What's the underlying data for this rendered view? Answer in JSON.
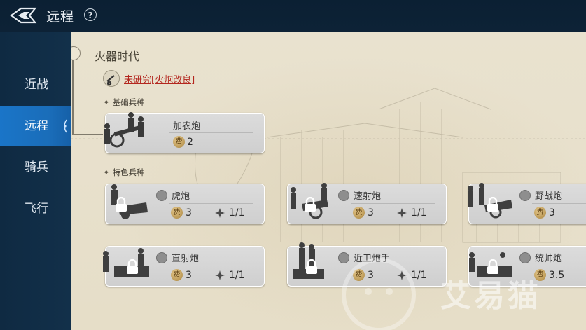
{
  "header": {
    "title": "远程",
    "help_label": "?"
  },
  "sidebar": {
    "items": [
      {
        "label": "近战"
      },
      {
        "label": "远程"
      },
      {
        "label": "骑兵"
      },
      {
        "label": "飞行"
      }
    ],
    "active_index": 1
  },
  "era": {
    "title": "火器时代",
    "research_status": "未研究[火炮改良]"
  },
  "sections": {
    "base": "基础兵种",
    "special": "特色兵种"
  },
  "cost_icon_label": "费",
  "units": {
    "base": [
      {
        "name": "加农炮",
        "cost": "2",
        "icon": "cannon-crew-icon"
      }
    ],
    "special": [
      {
        "name": "虎炮",
        "cost": "3",
        "limit": "1/1",
        "locked": true,
        "type_icon": "sword-icon"
      },
      {
        "name": "速射炮",
        "cost": "3",
        "limit": "1/1",
        "locked": true,
        "type_icon": "shield-icon"
      },
      {
        "name": "野战炮",
        "cost": "3",
        "limit": "",
        "locked": true,
        "type_icon": "shield-icon"
      },
      {
        "name": "直射炮",
        "cost": "3",
        "limit": "1/1",
        "locked": true,
        "type_icon": "shield-icon"
      },
      {
        "name": "近卫炮手",
        "cost": "3",
        "limit": "1/1",
        "locked": true,
        "type_icon": "shield-icon"
      },
      {
        "name": "统帅炮",
        "cost": "3.5",
        "limit": "",
        "locked": true,
        "type_icon": "banner-icon"
      }
    ]
  },
  "watermark": "艾易猫",
  "colors": {
    "active_tab": "#1a6db9",
    "research_text": "#b3261e",
    "parchment": "#e7e0cb"
  }
}
